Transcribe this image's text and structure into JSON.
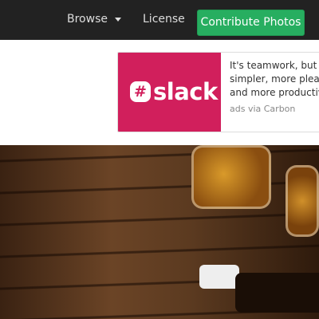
{
  "nav": {
    "browse_label": "Browse",
    "license_label": "License",
    "contribute_label": "Contribute Photos",
    "accent": "#27ae60"
  },
  "ad": {
    "brand": "slack",
    "brand_mark": "#",
    "brand_color": "#d11f5c",
    "lines": [
      "It's teamwork, but",
      "simpler, more pleas",
      "and more productiv"
    ],
    "via": "ads via Carbon"
  }
}
